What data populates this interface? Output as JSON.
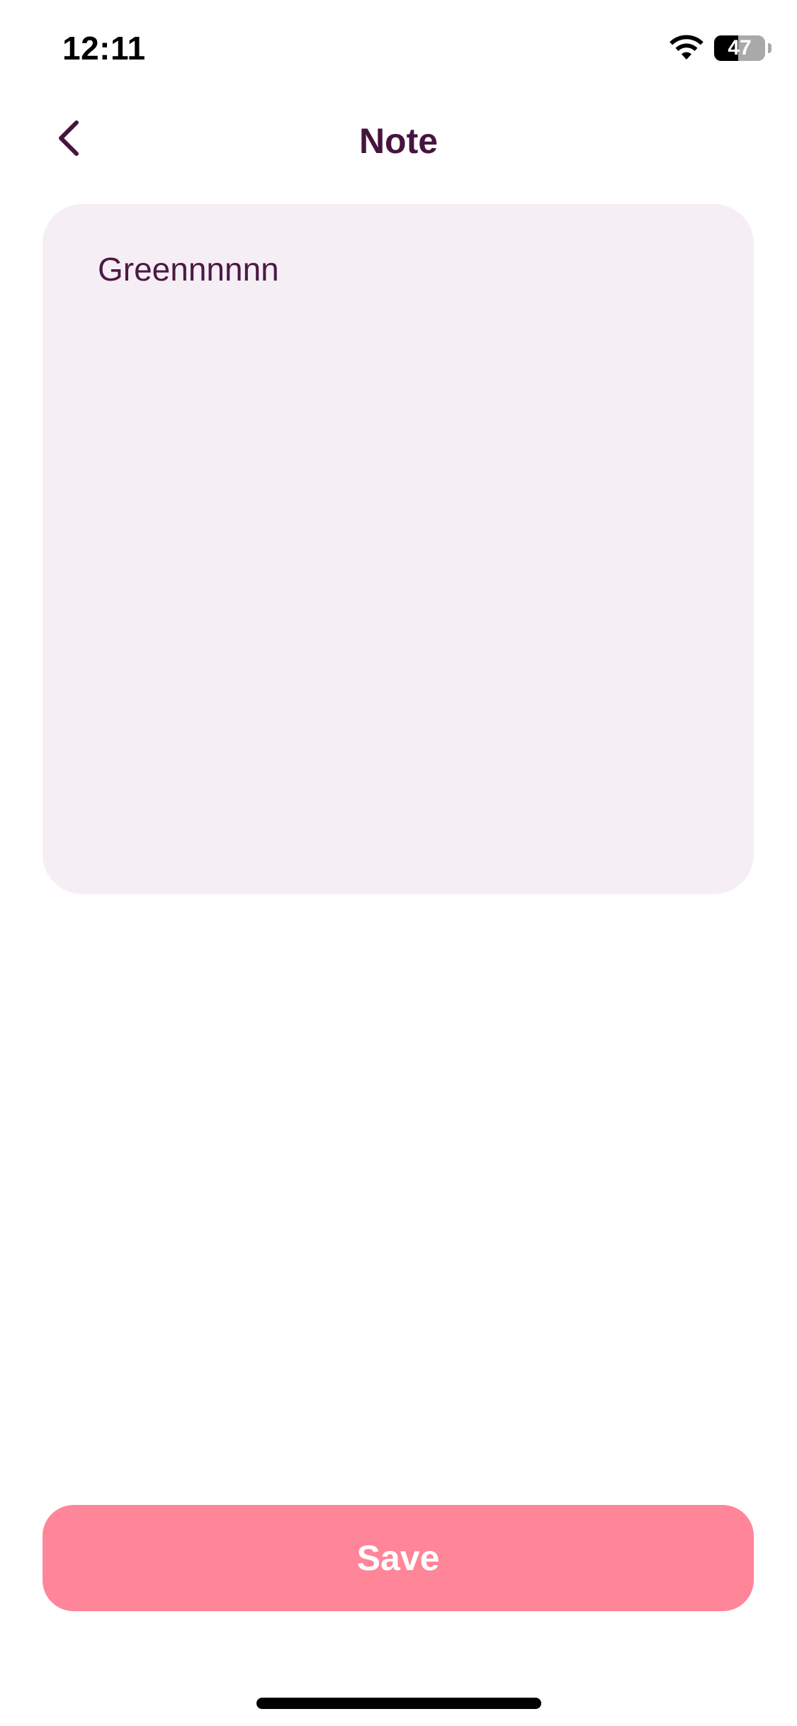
{
  "status_bar": {
    "time": "12:11",
    "battery_percent": 47,
    "battery_label": "47"
  },
  "nav": {
    "title": "Note",
    "back_icon": "chevron-left-icon"
  },
  "note": {
    "value": "Greennnnnn",
    "background_color": "#f6eef5",
    "text_color": "#4a1a44"
  },
  "actions": {
    "save_label": "Save",
    "save_color": "#ff8599"
  },
  "colors": {
    "title": "#46143e",
    "accent": "#ff8599"
  }
}
